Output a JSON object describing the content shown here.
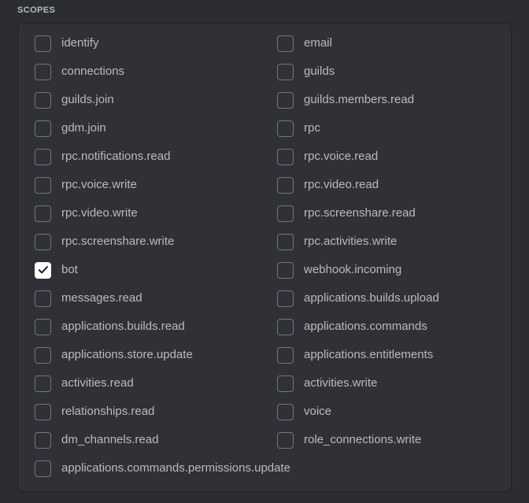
{
  "section": {
    "heading": "SCOPES"
  },
  "colors": {
    "page_background": "#2b2d31",
    "card_background": "#2f3136",
    "card_border": "#202225",
    "label_text": "#b9bbbe",
    "heading_text": "#b5bac1",
    "checkbox_border": "#72767d",
    "checkbox_checked_fill": "#ffffff",
    "checkbox_check_mark": "#17181b"
  },
  "scopes": {
    "columns": 2,
    "rows": [
      {
        "left": {
          "label": "identify",
          "checked": false
        },
        "right": {
          "label": "email",
          "checked": false
        }
      },
      {
        "left": {
          "label": "connections",
          "checked": false
        },
        "right": {
          "label": "guilds",
          "checked": false
        }
      },
      {
        "left": {
          "label": "guilds.join",
          "checked": false
        },
        "right": {
          "label": "guilds.members.read",
          "checked": false
        }
      },
      {
        "left": {
          "label": "gdm.join",
          "checked": false
        },
        "right": {
          "label": "rpc",
          "checked": false
        }
      },
      {
        "left": {
          "label": "rpc.notifications.read",
          "checked": false
        },
        "right": {
          "label": "rpc.voice.read",
          "checked": false
        }
      },
      {
        "left": {
          "label": "rpc.voice.write",
          "checked": false
        },
        "right": {
          "label": "rpc.video.read",
          "checked": false
        }
      },
      {
        "left": {
          "label": "rpc.video.write",
          "checked": false
        },
        "right": {
          "label": "rpc.screenshare.read",
          "checked": false
        }
      },
      {
        "left": {
          "label": "rpc.screenshare.write",
          "checked": false
        },
        "right": {
          "label": "rpc.activities.write",
          "checked": false
        }
      },
      {
        "left": {
          "label": "bot",
          "checked": true
        },
        "right": {
          "label": "webhook.incoming",
          "checked": false
        }
      },
      {
        "left": {
          "label": "messages.read",
          "checked": false
        },
        "right": {
          "label": "applications.builds.upload",
          "checked": false
        }
      },
      {
        "left": {
          "label": "applications.builds.read",
          "checked": false
        },
        "right": {
          "label": "applications.commands",
          "checked": false
        }
      },
      {
        "left": {
          "label": "applications.store.update",
          "checked": false
        },
        "right": {
          "label": "applications.entitlements",
          "checked": false
        }
      },
      {
        "left": {
          "label": "activities.read",
          "checked": false
        },
        "right": {
          "label": "activities.write",
          "checked": false
        }
      },
      {
        "left": {
          "label": "relationships.read",
          "checked": false
        },
        "right": {
          "label": "voice",
          "checked": false
        }
      },
      {
        "left": {
          "label": "dm_channels.read",
          "checked": false
        },
        "right": {
          "label": "role_connections.write",
          "checked": false
        }
      },
      {
        "left": {
          "label": "applications.commands.permissions.update",
          "checked": false
        },
        "right": null
      }
    ]
  }
}
